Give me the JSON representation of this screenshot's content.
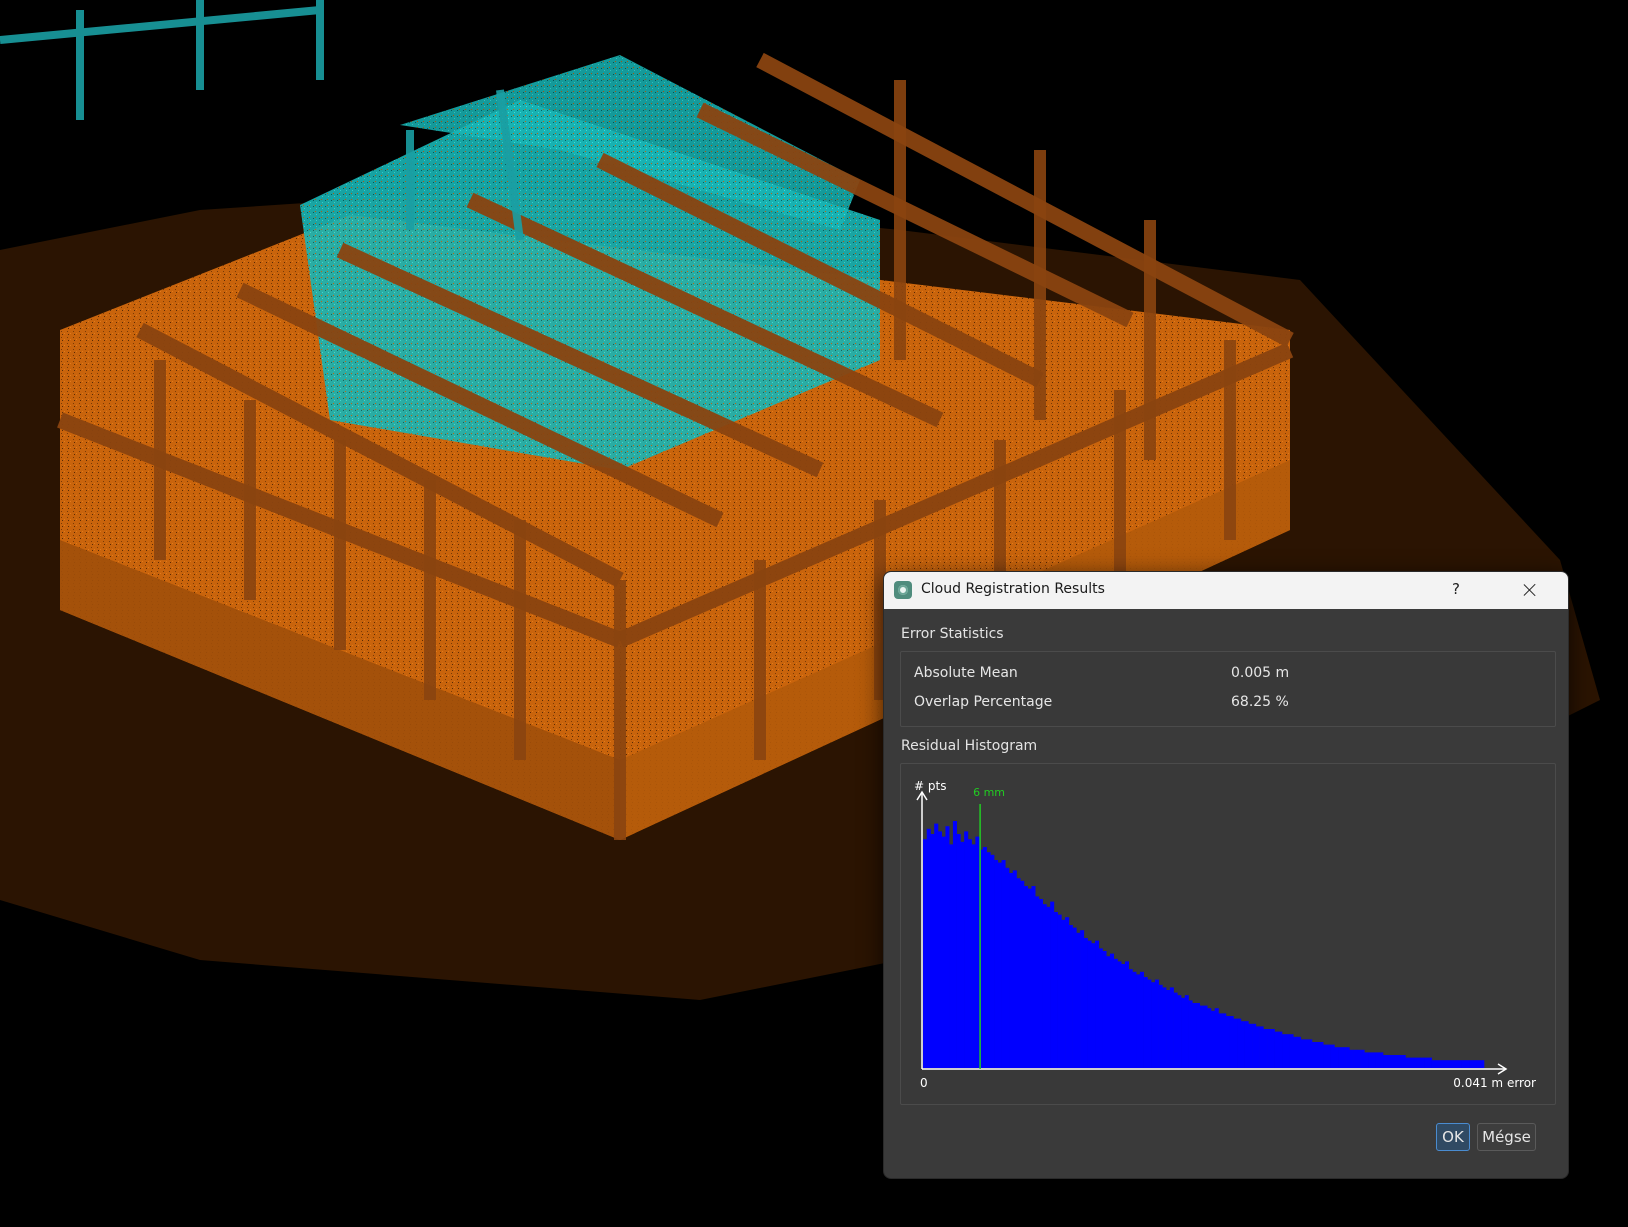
{
  "dialog": {
    "title": "Cloud Registration Results",
    "help_label": "?",
    "error_statistics": {
      "title": "Error Statistics",
      "rows": [
        {
          "label": "Absolute Mean",
          "value": "0.005 m"
        },
        {
          "label": "Overlap Percentage",
          "value": "68.25 %"
        }
      ]
    },
    "histogram": {
      "title": "Residual Histogram",
      "y_axis_label": "# pts",
      "x_min_label": "0",
      "x_max_label": "0.041 m error",
      "marker_label": "6 mm"
    },
    "buttons": {
      "ok": "OK",
      "cancel": "Mégse"
    }
  },
  "colors": {
    "cloud_reference": "#c9640c",
    "cloud_aligned": "#19c3c3",
    "histogram_bars": "#0000ff",
    "marker_line": "#22cc22",
    "dialog_bg": "#3a3a3a"
  },
  "chart_data": {
    "type": "bar",
    "title": "Residual Histogram",
    "ylabel": "# pts",
    "xlabel": "error",
    "x_range_m": [
      0,
      0.041
    ],
    "marker_m": 0.006,
    "values": [
      88,
      92,
      90,
      94,
      91,
      89,
      93,
      86,
      95,
      90,
      87,
      91,
      88,
      86,
      89,
      84,
      85,
      83,
      82,
      80,
      79,
      80,
      77,
      75,
      76,
      73,
      72,
      70,
      69,
      70,
      66,
      65,
      63,
      62,
      64,
      60,
      59,
      57,
      58,
      55,
      54,
      52,
      53,
      50,
      49,
      48,
      49,
      46,
      45,
      43,
      44,
      42,
      41,
      40,
      41,
      38,
      37,
      36,
      37,
      35,
      34,
      33,
      34,
      32,
      31,
      30,
      31,
      29,
      28,
      27,
      28,
      26,
      25,
      25,
      24,
      24,
      23,
      22,
      23,
      21,
      21,
      20,
      20,
      19,
      19,
      18,
      18,
      17,
      17,
      16,
      16,
      15,
      15,
      15,
      14,
      14,
      13,
      13,
      13,
      12,
      12,
      11,
      11,
      11,
      10,
      10,
      10,
      9,
      9,
      9,
      8,
      8,
      8,
      8,
      7,
      7,
      7,
      7,
      6,
      6,
      6,
      6,
      6,
      5,
      5,
      5,
      5,
      5,
      5,
      4,
      4,
      4,
      4,
      4,
      4,
      4,
      3,
      3,
      3,
      3,
      3,
      3,
      3,
      3,
      3,
      3,
      3,
      3,
      3,
      3
    ],
    "ylim": [
      0,
      100
    ]
  }
}
